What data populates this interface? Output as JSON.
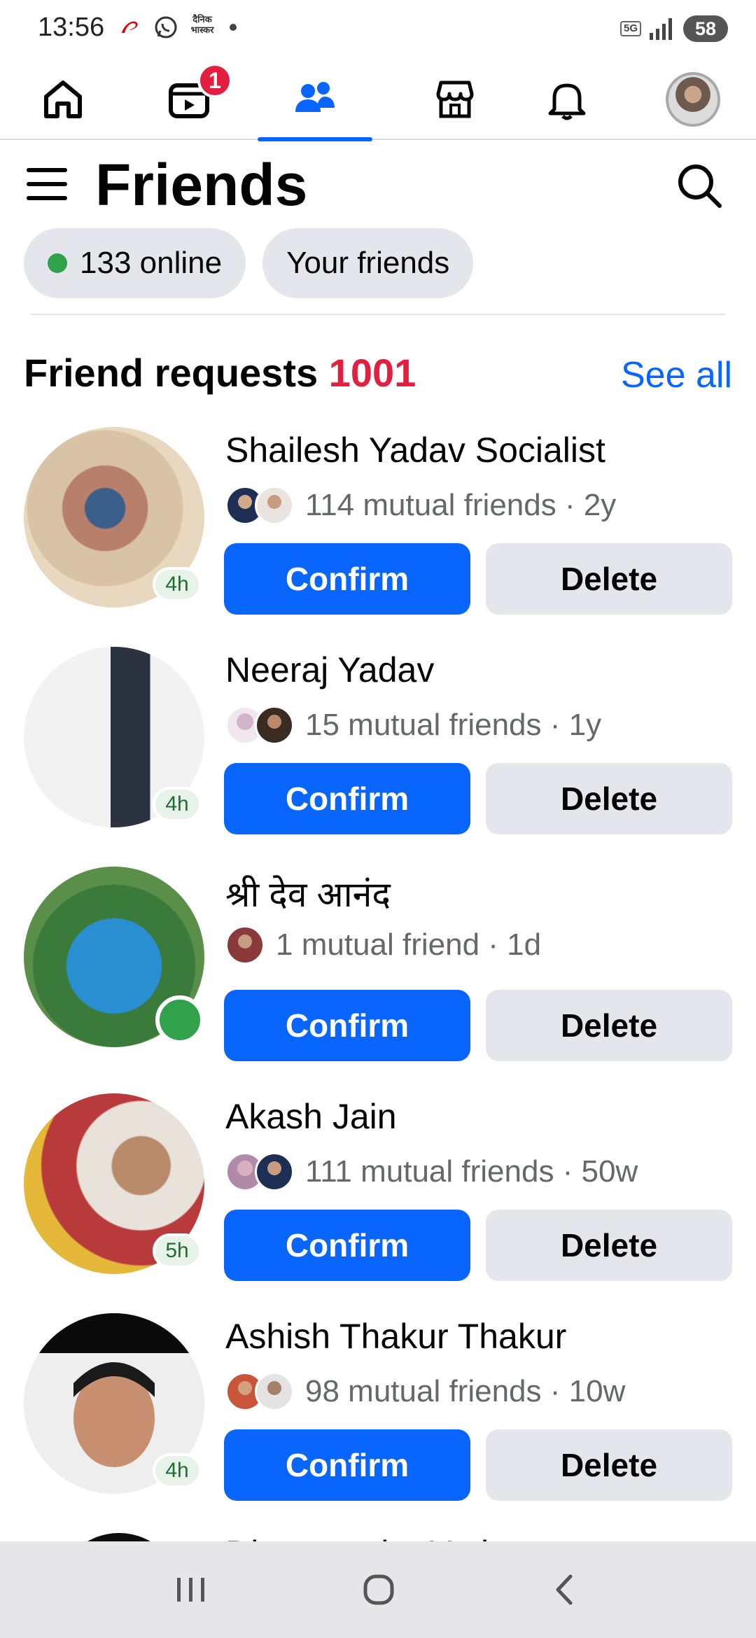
{
  "status_bar": {
    "time": "13:56",
    "notif_text": "दैनिक भास्कर",
    "network": "5G",
    "battery": "58"
  },
  "nav": {
    "video_badge": "1"
  },
  "header": {
    "title": "Friends"
  },
  "chips": {
    "online": "133 online",
    "your_friends": "Your friends"
  },
  "section": {
    "title": "Friend requests",
    "count": "1001",
    "see_all": "See all"
  },
  "requests": [
    {
      "name": "Shailesh Yadav Socialist",
      "mutual": "114 mutual friends · 2y",
      "time": "4h"
    },
    {
      "name": "Neeraj Yadav",
      "mutual": "15 mutual friends · 1y",
      "time": "4h"
    },
    {
      "name": "श्री देव आनंद",
      "mutual": "1 mutual friend · 1d",
      "time": ""
    },
    {
      "name": "Akash Jain",
      "mutual": "111 mutual friends · 50w",
      "time": "5h"
    },
    {
      "name": "Ashish Thakur Thakur",
      "mutual": "98 mutual friends · 10w",
      "time": "4h"
    }
  ],
  "buttons": {
    "confirm": "Confirm",
    "delete": "Delete"
  },
  "peek_name": "Dharmendra Yadav",
  "colors": {
    "accent": "#0866ff",
    "count_red": "#e41e3f",
    "online_green": "#31a24c"
  }
}
